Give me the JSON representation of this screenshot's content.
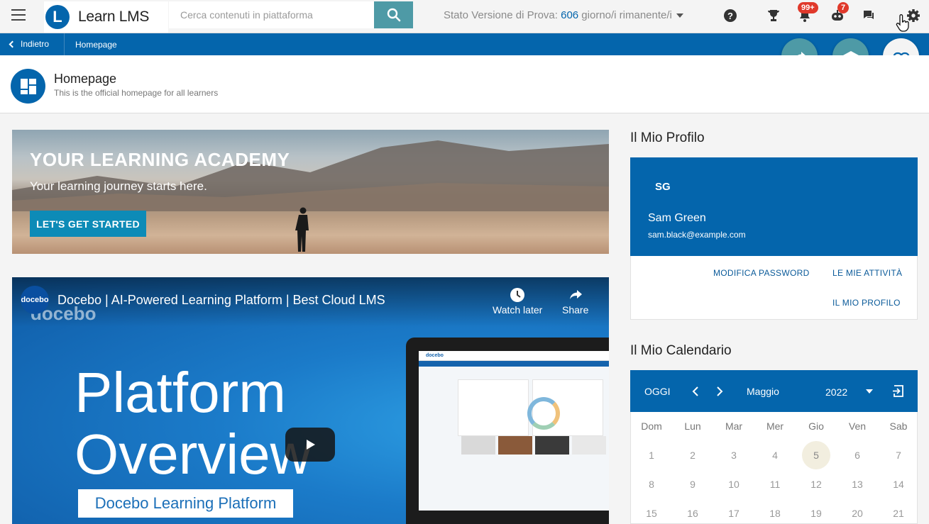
{
  "header": {
    "logo_letter": "L",
    "app_name": "Learn LMS",
    "search_placeholder": "Cerca contenuti in piattaforma",
    "trial_prefix": "Stato Versione di Prova: ",
    "trial_days": "606",
    "trial_suffix": " giorno/i rimanente/i",
    "notifications_badge": "99+",
    "assistant_badge": "7",
    "accent_color": "#0465ac"
  },
  "breadcrumb": {
    "back_label": "Indietro",
    "current": "Homepage"
  },
  "page": {
    "title": "Homepage",
    "subtitle": "This is the official homepage for all learners"
  },
  "banner": {
    "title": "YOUR LEARNING ACADEMY",
    "subtitle": "Your learning journey starts here.",
    "cta_label": "LET'S GET STARTED"
  },
  "video": {
    "channel_logo": "docebo",
    "title": "Docebo | AI-Powered Learning Platform | Best Cloud LMS",
    "watermark": "docebo",
    "watch_later": "Watch later",
    "share": "Share",
    "headline_line1": "Platform",
    "headline_line2": "Overview",
    "chip": "Docebo Learning Platform",
    "screen_brand": "docebo"
  },
  "profile": {
    "section_title": "Il Mio Profilo",
    "initials": "SG",
    "name": "Sam Green",
    "email": "sam.black@example.com",
    "links": {
      "change_password": "MODIFICA PASSWORD",
      "my_activities": "LE MIE ATTIVITÀ",
      "my_profile": "IL MIO PROFILO"
    }
  },
  "calendar": {
    "section_title": "Il Mio Calendario",
    "today_label": "OGGI",
    "month": "Maggio",
    "year": "2022",
    "weekdays": [
      "Dom",
      "Lun",
      "Mar",
      "Mer",
      "Gio",
      "Ven",
      "Sab"
    ],
    "weeks": [
      [
        "1",
        "2",
        "3",
        "4",
        "5",
        "6",
        "7"
      ],
      [
        "8",
        "9",
        "10",
        "11",
        "12",
        "13",
        "14"
      ],
      [
        "15",
        "16",
        "17",
        "18",
        "19",
        "20",
        "21"
      ]
    ],
    "today": "5"
  }
}
